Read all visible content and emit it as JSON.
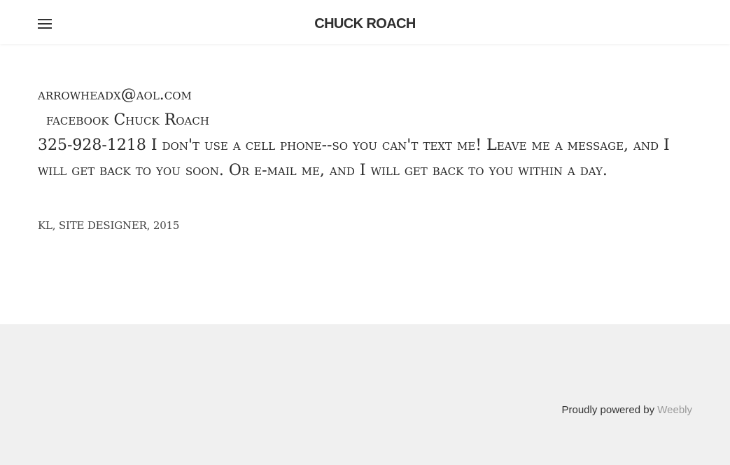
{
  "header": {
    "site_title": "CHUCK ROACH",
    "menu_icon": "hamburger-menu-icon"
  },
  "content": {
    "email": "arrowheadx@aol.com",
    "facebook": "facebook Chuck Roach",
    "contact_text": "325-928-1218  I don't use a cell phone--so you can't text me!  Leave me a message, and I will get back to you soon.  Or e-mail me, and I will get back to you within a day.",
    "credit": "KL, SITE DESIGNER, 2015"
  },
  "footer": {
    "powered_by": "Proudly powered by",
    "weebly_link": "Weebly"
  },
  "colors": {
    "footer_bg": "#f0f0f0",
    "link_muted": "#999999"
  }
}
